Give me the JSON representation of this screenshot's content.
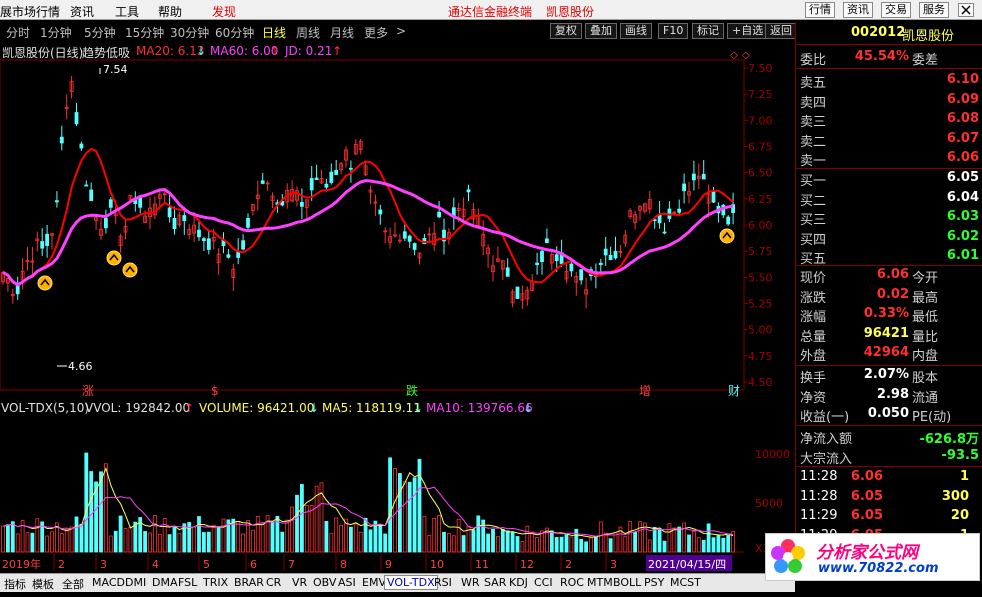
{
  "menubar": {
    "items": [
      "展市场行情",
      "分时",
      "1分钟",
      "5分钟",
      "15分钟",
      "30分钟",
      "60分钟",
      "日线",
      "周线",
      "月线",
      "更多"
    ],
    "top_items": [
      "资讯",
      "工具",
      "帮助"
    ],
    "discover": "发现",
    "promo": "通达信金融终端",
    "stock_title": "凯恩股份",
    "right_buttons": [
      "行情",
      "资讯",
      "交易",
      "服务"
    ]
  },
  "toolbar": {
    "periods": [
      "分时",
      "1分钟",
      "5分钟",
      "15分钟",
      "30分钟",
      "60分钟",
      "日线",
      "周线",
      "月线",
      "更多"
    ],
    "selected_period": "日线",
    "more_arrow": ">",
    "buttons": [
      "复权",
      "叠加",
      "画线",
      "F10",
      "标记",
      "+自选",
      "返回"
    ]
  },
  "info": {
    "title": "凯恩股份(日线)",
    "indicator": "趋势低吸",
    "ma20": "MA20: 6.13",
    "ma60": "MA60: 6.00",
    "jd": "JD: 0.21",
    "arrow_down": "↓",
    "arrow_up": "↑"
  },
  "price_axis": [
    "7.50",
    "7.25",
    "7.00",
    "6.75",
    "6.50",
    "6.25",
    "6.00",
    "5.75",
    "5.50",
    "5.25",
    "5.00",
    "4.75",
    "4.50"
  ],
  "annotations": {
    "high": "7.54",
    "low": "4.66"
  },
  "event_markers": [
    "涨",
    "$",
    "跌",
    "增",
    "财"
  ],
  "volume_header": {
    "name": "VOL-TDX(5,10)",
    "vvol": "VVOL: 192842.00",
    "volume": "VOLUME: 96421.00",
    "ma5": "MA5: 118119.11",
    "ma10": "MA10: 139766.66",
    "arrow_up": "↑",
    "arrow_down": "↓"
  },
  "volume_axis": [
    "10000",
    "5000",
    "X10"
  ],
  "date_axis": {
    "year": "2019年",
    "months": [
      "2",
      "3",
      "4",
      "5",
      "6",
      "7",
      "8",
      "9",
      "10",
      "11",
      "12",
      "2",
      "3"
    ],
    "current": "2021/04/15/四"
  },
  "bottom_tabs": [
    "指标",
    "模板",
    "全部",
    "MACD",
    "DMI",
    "DMA",
    "FSL",
    "TRIX",
    "BRAR",
    "CR",
    "VR",
    "OBV",
    "ASI",
    "EMV",
    "VOL-TDX",
    "RSI",
    "WR",
    "SAR",
    "KDJ",
    "CCI",
    "ROC",
    "MTM",
    "BOLL",
    "PSY",
    "MCST"
  ],
  "selected_tab": "VOL-TDX",
  "quote": {
    "code": "002012",
    "name": "凯恩股份",
    "weibi_label": "委比",
    "weibi": "45.54%",
    "weicha_label": "委差",
    "asks": [
      {
        "label": "卖五",
        "price": "6.10"
      },
      {
        "label": "卖四",
        "price": "6.09"
      },
      {
        "label": "卖三",
        "price": "6.08"
      },
      {
        "label": "卖二",
        "price": "6.07"
      },
      {
        "label": "卖一",
        "price": "6.06"
      }
    ],
    "bids": [
      {
        "label": "买一",
        "price": "6.05"
      },
      {
        "label": "买二",
        "price": "6.04"
      },
      {
        "label": "买三",
        "price": "6.03"
      },
      {
        "label": "买四",
        "price": "6.02"
      },
      {
        "label": "买五",
        "price": "6.01"
      }
    ],
    "stats": [
      {
        "label": "现价",
        "value": "6.06",
        "label2": "今开",
        "color": "#ff3030"
      },
      {
        "label": "涨跌",
        "value": "0.02",
        "label2": "最高",
        "color": "#ff3030"
      },
      {
        "label": "涨幅",
        "value": "0.33%",
        "label2": "最低",
        "color": "#ff3030"
      },
      {
        "label": "总量",
        "value": "96421",
        "label2": "量比",
        "color": "#ffff54"
      },
      {
        "label": "外盘",
        "value": "42964",
        "label2": "内盘",
        "color": "#ff3030"
      }
    ],
    "stats2": [
      {
        "label": "换手",
        "value": "2.07%",
        "label2": "股本",
        "color": "#ffffff"
      },
      {
        "label": "净资",
        "value": "2.98",
        "label2": "流通",
        "color": "#ffffff"
      },
      {
        "label": "收益(一)",
        "value": "0.050",
        "label2": "PE(动)",
        "color": "#ffffff"
      }
    ],
    "flow": [
      {
        "label": "净流入额",
        "value": "-626.8万",
        "color": "#30ff30"
      },
      {
        "label": "大宗流入",
        "value": "-93.5",
        "color": "#30ff30"
      }
    ],
    "ticks": [
      {
        "time": "11:28",
        "price": "6.06",
        "vol": "1",
        "vcolor": "#ffff54"
      },
      {
        "time": "11:28",
        "price": "6.05",
        "vol": "300",
        "vcolor": "#ffff54"
      },
      {
        "time": "11:29",
        "price": "6.05",
        "vol": "20",
        "vcolor": "#ffff54"
      },
      {
        "time": "11:29",
        "price": "6.05",
        "vol": "1",
        "vcolor": "#ffff54"
      }
    ]
  },
  "watermark": {
    "text": "分析家公式网",
    "url": "www.70822.com"
  },
  "colors": {
    "up": "#ff3030",
    "down": "#54ffff",
    "ma20": "#ff0000",
    "ma60": "#ff40ff",
    "grid": "#800000"
  }
}
